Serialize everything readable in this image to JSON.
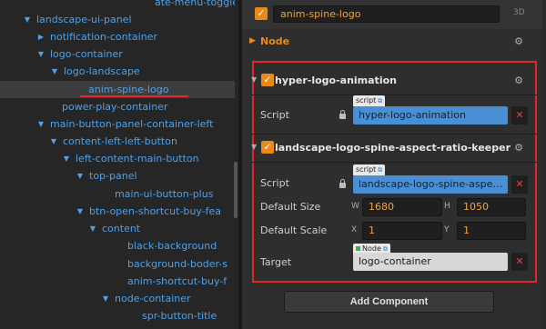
{
  "hierarchy": {
    "rows": [
      {
        "label": "ate-menu-toggle",
        "has_arrow": false,
        "selected": false
      },
      {
        "label": "landscape-ui-panel",
        "has_arrow": true,
        "expanded": true,
        "selected": false
      },
      {
        "label": "notification-container",
        "has_arrow": true,
        "expanded": false,
        "selected": false
      },
      {
        "label": "logo-container",
        "has_arrow": true,
        "expanded": true,
        "selected": false
      },
      {
        "label": "logo-landscape",
        "has_arrow": true,
        "expanded": true,
        "selected": false
      },
      {
        "label": "anim-spine-logo",
        "has_arrow": false,
        "selected": true
      },
      {
        "label": "power-play-container",
        "has_arrow": false,
        "selected": false
      },
      {
        "label": "main-button-panel-container-left",
        "has_arrow": true,
        "expanded": true,
        "selected": false
      },
      {
        "label": "content-left-left-button",
        "has_arrow": true,
        "expanded": true,
        "selected": false
      },
      {
        "label": "left-content-main-button",
        "has_arrow": true,
        "expanded": true,
        "selected": false
      },
      {
        "label": "top-panel",
        "has_arrow": true,
        "expanded": true,
        "selected": false
      },
      {
        "label": "main-ui-button-plus",
        "has_arrow": false,
        "selected": false
      },
      {
        "label": "btn-open-shortcut-buy-fea",
        "has_arrow": true,
        "expanded": true,
        "selected": false
      },
      {
        "label": "content",
        "has_arrow": true,
        "expanded": true,
        "selected": false
      },
      {
        "label": "black-background",
        "has_arrow": false,
        "selected": false
      },
      {
        "label": "background-boder-s",
        "has_arrow": false,
        "selected": false
      },
      {
        "label": "anim-shortcut-buy-f",
        "has_arrow": false,
        "selected": false
      },
      {
        "label": "node-container",
        "has_arrow": true,
        "expanded": true,
        "selected": false
      },
      {
        "label": "spr-button-title",
        "has_arrow": false,
        "selected": false
      }
    ]
  },
  "inspector": {
    "node_name": "anim-spine-logo",
    "node_active": true,
    "mode_tag": "3D",
    "node_section_title": "Node",
    "components": [
      {
        "title": "hyper-logo-animation",
        "enabled": true,
        "props": [
          {
            "label": "Script",
            "tag": "script",
            "value": "hyper-logo-animation"
          }
        ]
      },
      {
        "title": "landscape-logo-spine-aspect-ratio-keeper",
        "enabled": true,
        "props": [
          {
            "label": "Script",
            "tag": "script",
            "value": "landscape-logo-spine-aspect-ratio-keeper"
          },
          {
            "label": "Default Size",
            "axis_x": "W",
            "value_x": "1680",
            "axis_y": "H",
            "value_y": "1050"
          },
          {
            "label": "Default Scale",
            "axis_x": "X",
            "value_x": "1",
            "axis_y": "Y",
            "value_y": "1"
          },
          {
            "label": "Target",
            "tag": "Node",
            "value": "logo-container"
          }
        ]
      }
    ],
    "add_component_label": "Add Component"
  },
  "colors": {
    "accent_orange": "#e88a1a",
    "tree_blue": "#4ea1ea",
    "highlight_red": "#e3262a",
    "script_field_blue": "#4a8fd4"
  }
}
